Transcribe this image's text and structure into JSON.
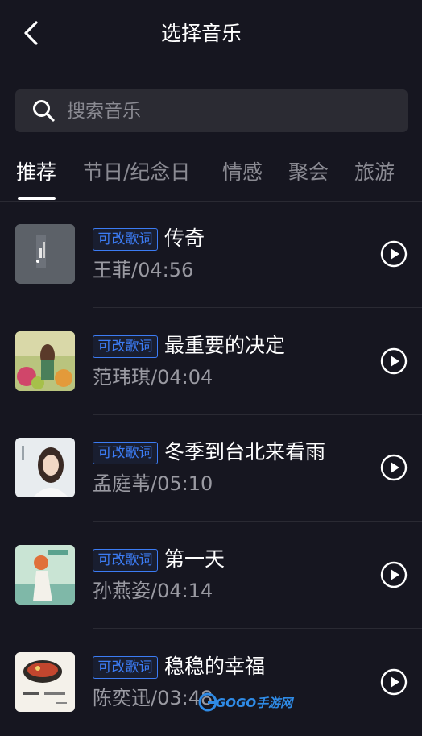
{
  "header": {
    "title": "选择音乐",
    "back_icon": "chevron-left-icon"
  },
  "search": {
    "placeholder": "搜索音乐",
    "value": "",
    "icon": "search-icon"
  },
  "tabs": [
    {
      "label": "推荐",
      "active": true
    },
    {
      "label": "节日/纪念日",
      "active": false
    },
    {
      "label": "情感",
      "active": false
    },
    {
      "label": "聚会",
      "active": false
    },
    {
      "label": "旅游",
      "active": false
    }
  ],
  "songs": [
    {
      "badge": "可改歌词",
      "title": "传奇",
      "meta": "王菲/04:56",
      "cover": "album-cover-gray"
    },
    {
      "badge": "可改歌词",
      "title": "最重要的决定",
      "meta": "范玮琪/04:04",
      "cover": "album-cover-flowers"
    },
    {
      "badge": "可改歌词",
      "title": "冬季到台北来看雨",
      "meta": "孟庭苇/05:10",
      "cover": "album-cover-portrait"
    },
    {
      "badge": "可改歌词",
      "title": "第一天",
      "meta": "孙燕姿/04:14",
      "cover": "album-cover-beach"
    },
    {
      "badge": "可改歌词",
      "title": "稳稳的幸福",
      "meta": "陈奕迅/03:48",
      "cover": "album-cover-bowl"
    }
  ],
  "watermark": {
    "text": "GOGO手游网"
  },
  "colors": {
    "background": "#161620",
    "accent": "#3c7cf4",
    "secondary_text": "#9a9aa2",
    "search_bg": "#2b2b33"
  }
}
